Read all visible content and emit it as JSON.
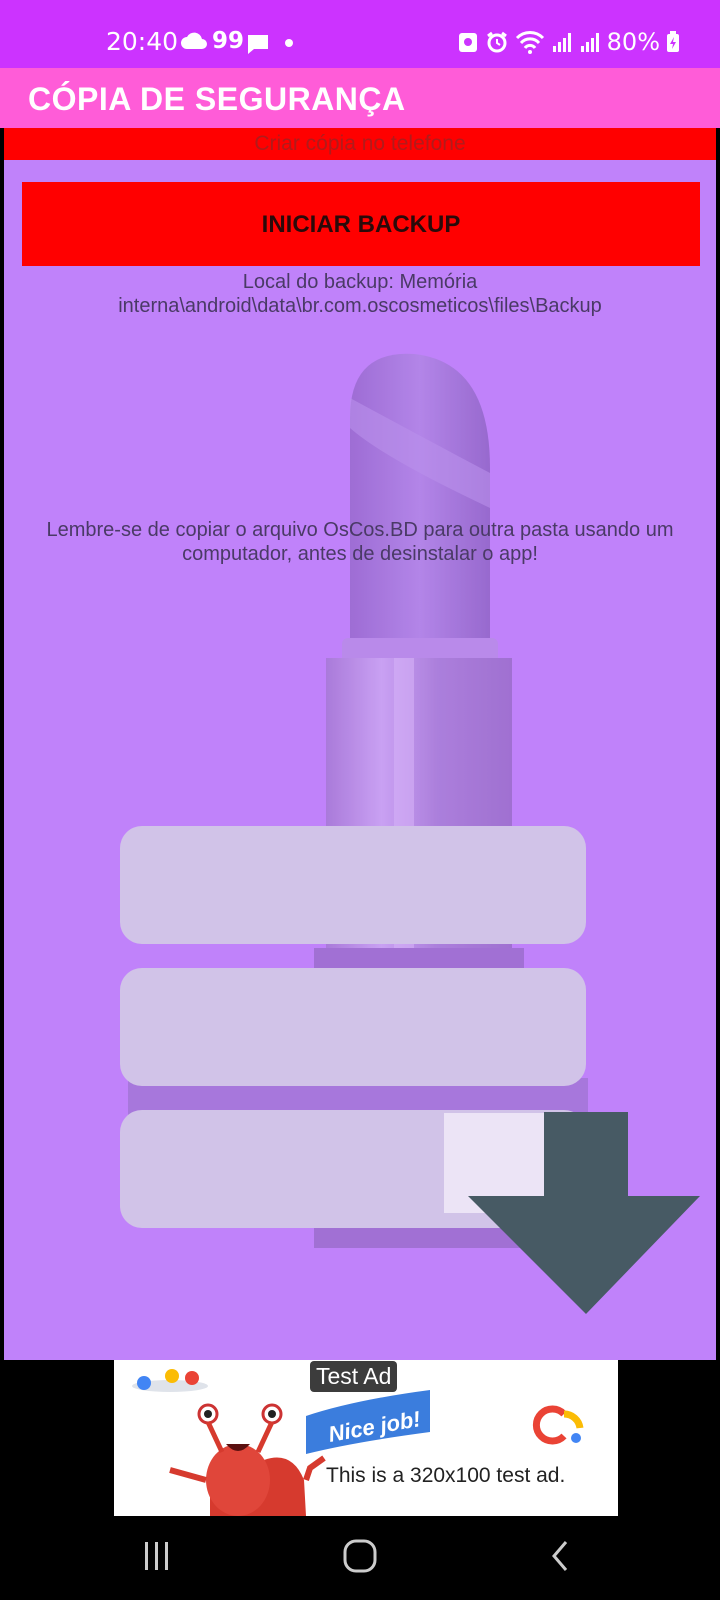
{
  "status_bar": {
    "time": "20:40",
    "notif_count": "99",
    "battery_percent": "80%",
    "icons": [
      "cloud-icon",
      "message-icon",
      "dot-icon",
      "battery-saver-icon",
      "alarm-icon",
      "wifi-icon",
      "signal-icon",
      "signal-icon",
      "battery-charging-icon"
    ]
  },
  "app_bar": {
    "title": "CÓPIA DE SEGURANÇA"
  },
  "content": {
    "subheader": "Criar cópia no telefone",
    "start_button_label": "INICIAR BACKUP",
    "backup_location": "Local do backup: Memória interna\\android\\data\\br.com.oscosmeticos\\files\\Backup",
    "reminder": "Lembre-se de copiar o arquivo OsCos.BD para outra pasta usando um computador, antes de desinstalar o app!",
    "background_icons": [
      "lipstick-icon",
      "download-arrow-icon"
    ]
  },
  "ad": {
    "badge": "Test Ad",
    "flag_text": "Nice job!",
    "text": "This is a 320x100 test ad."
  },
  "nav_bar": {
    "icons": [
      "recent-apps-icon",
      "home-icon",
      "back-icon"
    ]
  },
  "colors": {
    "status_bar": "#cc33ff",
    "app_bar": "#ff5cd8",
    "content_bg": "#c082fa",
    "accent_red": "#ff0000"
  }
}
